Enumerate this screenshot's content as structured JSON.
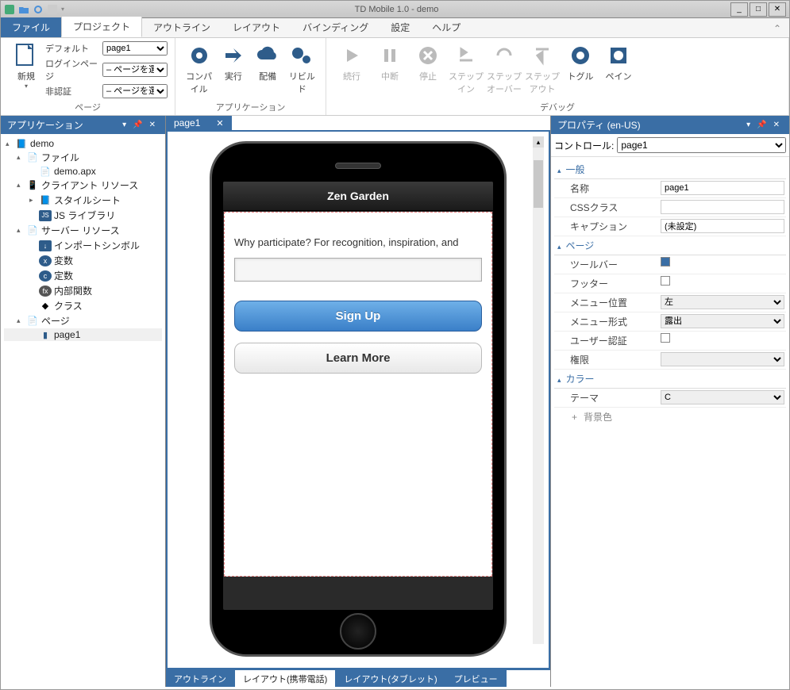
{
  "window": {
    "title": "TD Mobile 1.0 - demo"
  },
  "menu": {
    "file": "ファイル",
    "items": [
      "プロジェクト",
      "アウトライン",
      "レイアウト",
      "バインディング",
      "設定",
      "ヘルプ"
    ]
  },
  "ribbon": {
    "new_btn": "新規",
    "page_group": {
      "label": "ページ",
      "default": "デフォルト",
      "default_val": "page1",
      "login": "ログインページ",
      "login_val": "– ページを選択 –",
      "noauth": "非認証",
      "noauth_val": "– ページを選択 –"
    },
    "app_group": {
      "label": "アプリケーション",
      "compile": "コンパイル",
      "run": "実行",
      "deploy": "配備",
      "rebuild": "リビルド"
    },
    "debug_group": {
      "label": "デバッグ",
      "continue": "続行",
      "break": "中断",
      "stop": "停止",
      "stepin": "ステップイン",
      "stepover": "ステップオーバー",
      "stepout": "ステップアウト",
      "toggle": "トグル",
      "pane": "ペイン"
    }
  },
  "app_panel": {
    "title": "アプリケーション",
    "tree": {
      "root": "demo",
      "files": "ファイル",
      "demo_apx": "demo.apx",
      "client": "クライアント リソース",
      "stylesheet": "スタイルシート",
      "jslib": "JS ライブラリ",
      "server": "サーバー リソース",
      "import": "インポートシンボル",
      "vars": "変数",
      "consts": "定数",
      "intfunc": "内部関数",
      "classes": "クラス",
      "pages": "ページ",
      "page1": "page1"
    }
  },
  "center": {
    "tab": "page1",
    "app_title": "Zen Garden",
    "body_text": "Why participate? For recognition, inspiration, and",
    "signup": "Sign Up",
    "learnmore": "Learn More",
    "bottom_tabs": [
      "アウトライン",
      "レイアウト(携帯電話)",
      "レイアウト(タブレット)",
      "プレビュー"
    ]
  },
  "props": {
    "title": "プロパティ (en-US)",
    "control_label": "コントロール:",
    "control_val": "page1",
    "cat_general": "一般",
    "name": "名称",
    "name_val": "page1",
    "cssclass": "CSSクラス",
    "cssclass_val": "",
    "caption": "キャプション",
    "caption_val": "(未設定)",
    "cat_page": "ページ",
    "toolbar": "ツールバー",
    "footer": "フッター",
    "menupos": "メニュー位置",
    "menupos_val": "左",
    "menutype": "メニュー形式",
    "menutype_val": "露出",
    "userauth": "ユーザー認証",
    "perm": "権限",
    "cat_color": "カラー",
    "theme": "テーマ",
    "theme_val": "C",
    "bgcolor": "背景色"
  }
}
